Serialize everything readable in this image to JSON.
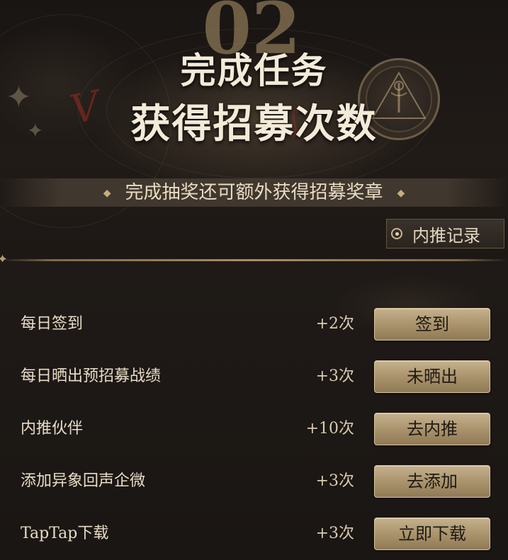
{
  "hero": {
    "number": "02",
    "title_line1": "完成任务",
    "title_line2": "获得招募次数",
    "subtitle": "完成抽奖还可额外获得招募奖章",
    "referral_button": "内推记录"
  },
  "tasks": [
    {
      "name": "每日签到",
      "reward": "+2次",
      "button": "签到"
    },
    {
      "name": "每日晒出预招募战绩",
      "reward": "+3次",
      "button": "未晒出"
    },
    {
      "name": "内推伙伴",
      "reward": "+10次",
      "button": "去内推"
    },
    {
      "name": "添加异象回声企微",
      "reward": "+3次",
      "button": "去添加"
    },
    {
      "name": "TapTap下载",
      "reward": "+3次",
      "button": "立即下载"
    }
  ],
  "colors": {
    "background": "#1c1714",
    "button_gold": "#b29c75",
    "text_light": "#e8dcc6",
    "accent_red": "#962d23"
  },
  "icons": [
    "diamond-icon",
    "sparkle-icon",
    "seal-emblem-icon",
    "radio-dot-icon"
  ]
}
